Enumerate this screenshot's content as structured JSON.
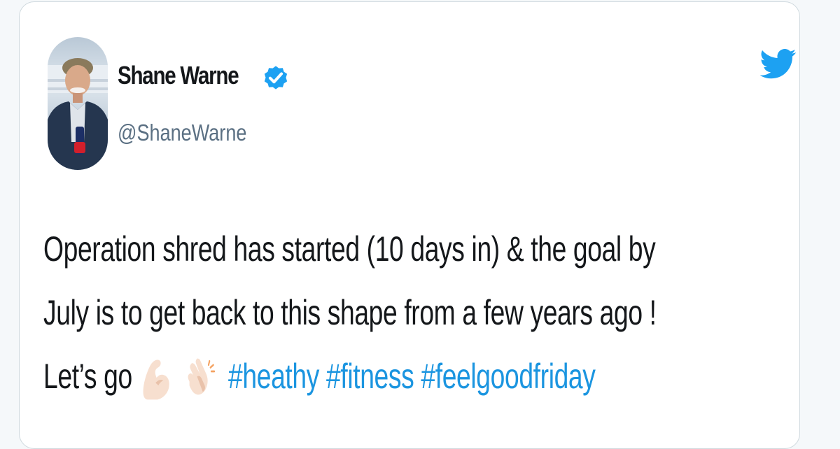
{
  "user": {
    "display_name": "Shane Warne",
    "handle": "@ShaneWarne",
    "verified": true
  },
  "tweet": {
    "line1": "Operation shred has started (10 days in) & the goal by",
    "line2": "July is to get back to this shape from a few years ago !",
    "line3_prefix": "Let’s go",
    "emojis": [
      "flexed-biceps-icon",
      "clapping-hands-icon"
    ],
    "hashtags": [
      "#heathy",
      "#fitness",
      "#feelgoodfriday"
    ]
  },
  "colors": {
    "link": "#1b95e0",
    "twitter_brand": "#1da1f2",
    "text": "#14171a",
    "secondary": "#5b7083"
  }
}
